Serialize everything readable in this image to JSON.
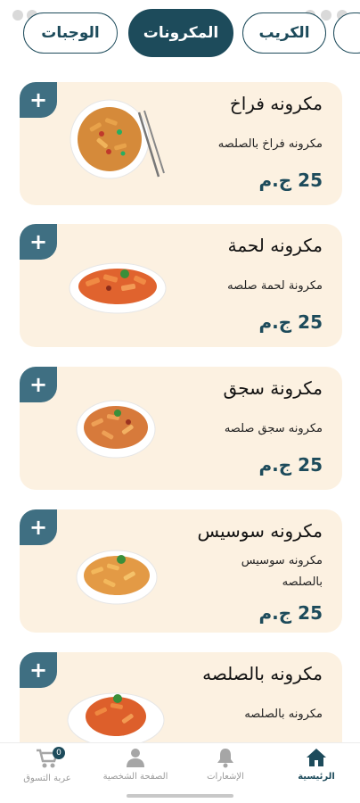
{
  "tabs": [
    {
      "label": "الوجبات"
    },
    {
      "label": "المكرونات",
      "active": true
    },
    {
      "label": "الكريب"
    }
  ],
  "accent_color": "#1d4b5b",
  "card_color": "#fcf1e1",
  "products": [
    {
      "name": "مكرونه فراخ",
      "desc": "مكرونه فراخ بالصلصه",
      "price": "25 ج.م",
      "add_label": "+",
      "icon": "pasta-chicken-plate"
    },
    {
      "name": "مكرونه لحمة",
      "desc": "مكرونة لحمة صلصه",
      "price": "25 ج.م",
      "add_label": "+",
      "icon": "pasta-meat-plate"
    },
    {
      "name": "مكرونة سجق",
      "desc": "مكرونه سجق صلصه",
      "price": "25 ج.م",
      "add_label": "+",
      "icon": "pasta-sausage-plate"
    },
    {
      "name": "مكرونه سوسيس",
      "desc": "مكرونه سوسيس بالصلصه",
      "price": "25 ج.م",
      "add_label": "+",
      "icon": "pasta-hotdog-plate"
    },
    {
      "name": "مكرونه بالصلصه",
      "desc": "مكرونه بالصلصه",
      "price": "",
      "add_label": "+",
      "icon": "pasta-sauce-plate"
    }
  ],
  "nav": {
    "home": "الرئيسية",
    "notifications": "الإشعارات",
    "profile": "الصفحة الشخصية",
    "cart": "عربة التسوق",
    "cart_count": "0"
  }
}
